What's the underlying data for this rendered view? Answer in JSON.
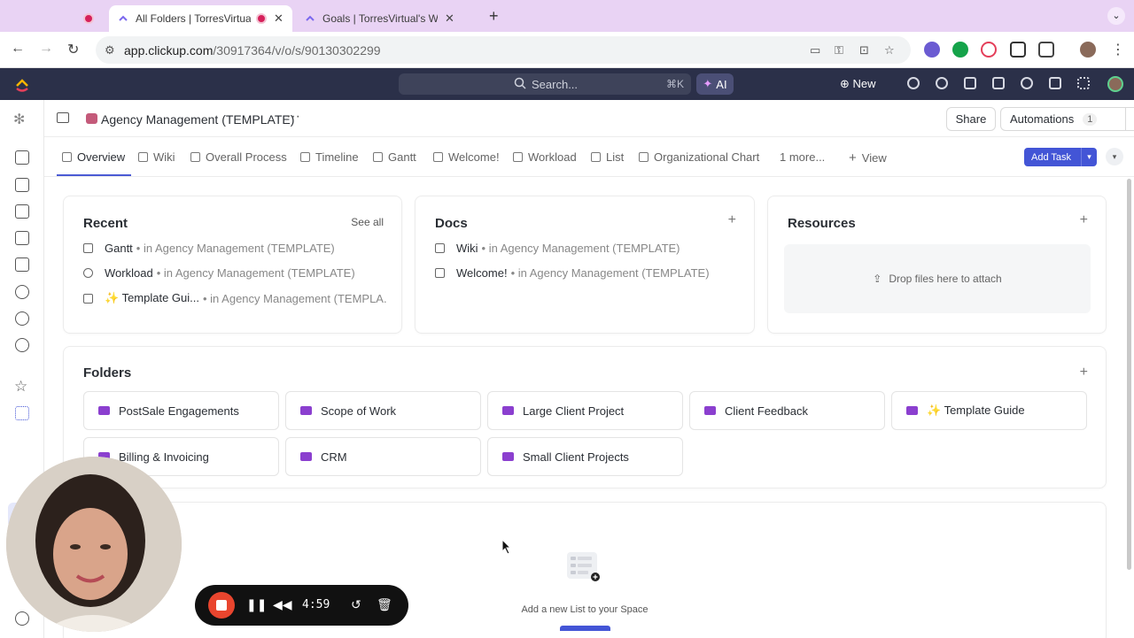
{
  "browser": {
    "tabs": [
      {
        "title": "All Folders | TorresVirtual's",
        "active": true
      },
      {
        "title": "Goals | TorresVirtual's Worksp",
        "active": false
      }
    ],
    "url_host": "app.clickup.com",
    "url_path": "/30917364/v/o/s/90130302299"
  },
  "appbar": {
    "search_placeholder": "Search...",
    "search_shortcut": "⌘K",
    "ai_label": "AI",
    "new_label": "New"
  },
  "header": {
    "space_title": "Agency Management (TEMPLATE)",
    "more_label": "···",
    "share_label": "Share",
    "automations_label": "Automations",
    "automations_count": "1"
  },
  "view_tabs": {
    "items": [
      {
        "label": "Overview"
      },
      {
        "label": "Wiki"
      },
      {
        "label": "Overall Process"
      },
      {
        "label": "Timeline"
      },
      {
        "label": "Gantt"
      },
      {
        "label": "Welcome!"
      },
      {
        "label": "Workload"
      },
      {
        "label": "List"
      },
      {
        "label": "Organizational Chart"
      },
      {
        "label": "1 more..."
      },
      {
        "label": "View"
      }
    ],
    "add_task_label": "Add Task"
  },
  "recent": {
    "title": "Recent",
    "see_all": "See all",
    "items": [
      {
        "name": "Gantt",
        "location": "• in Agency Management (TEMPLATE)"
      },
      {
        "name": "Workload",
        "location": "• in Agency Management (TEMPLATE)"
      },
      {
        "name": "✨ Template Gui...",
        "location": "• in Agency Management (TEMPLA..."
      }
    ]
  },
  "docs": {
    "title": "Docs",
    "items": [
      {
        "name": "Wiki",
        "location": "• in Agency Management (TEMPLATE)"
      },
      {
        "name": "Welcome!",
        "location": "• in Agency Management (TEMPLATE)"
      }
    ]
  },
  "resources": {
    "title": "Resources",
    "dropzone_text": "Drop files here to attach"
  },
  "folders": {
    "title": "Folders",
    "items": [
      {
        "name": "PostSale Engagements"
      },
      {
        "name": "Scope of Work"
      },
      {
        "name": "Large Client Project"
      },
      {
        "name": "Client Feedback"
      },
      {
        "name": "✨ Template Guide"
      },
      {
        "name": "Billing & Invoicing"
      },
      {
        "name": "CRM"
      },
      {
        "name": "Small Client Projects"
      }
    ]
  },
  "lists_empty": {
    "text": "Add a new List to your Space"
  },
  "recorder": {
    "time": "4:59"
  },
  "colors": {
    "accent": "#4355d6",
    "appbar": "#2b3049",
    "folder": "#8b3fcf",
    "tabstrip": "#e9d3f4",
    "record": "#e9452e"
  }
}
